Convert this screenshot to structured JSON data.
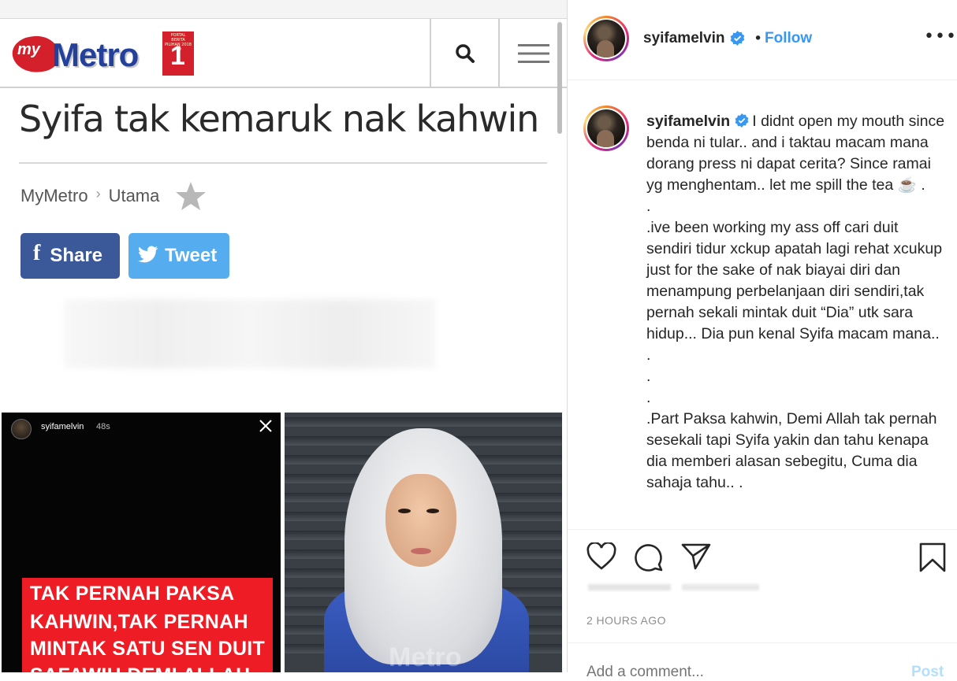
{
  "article": {
    "site_logo": {
      "my": "my",
      "brand": "Metro",
      "badge_number": "1",
      "badge_small_text": "PORTAL BERITA PILIHAN 2018 NO"
    },
    "headline": "Syifa tak kemaruk nak kahwin",
    "breadcrumb": [
      "MyMetro",
      "Utama"
    ],
    "share_label": "Share",
    "tweet_label": "Tweet",
    "story": {
      "username": "syifamelvin",
      "time": "48s",
      "callout_lines": [
        "TAK PERNAH PAKSA",
        "KAHWIN,TAK PERNAH",
        "MINTAK SATU SEN DUIT",
        "SAFAWIH.DEMI ALLAH"
      ]
    },
    "photo_watermark": "Metro",
    "icons": {
      "search": "search-icon",
      "menu": "hamburger-menu-icon",
      "star": "star-icon",
      "close": "close-icon"
    },
    "colors": {
      "facebook": "#3b5998",
      "twitter": "#55acee",
      "callout_red": "#ee1c24",
      "metro_blue": "#23409a"
    }
  },
  "instagram": {
    "username": "syifamelvin",
    "follow_label": "Follow",
    "more_icon": "•••",
    "caption_user": "syifamelvin",
    "caption_paragraphs": [
      "I didnt open my mouth since benda ni tular.. and i taktau macam mana dorang press ni dapat cerita? Since ramai yg menghentam.. let me spill the tea ☕ .",
      ".",
      ".ive been working my ass off cari duit sendiri tidur xckup apatah lagi rehat xcukup just for the sake of nak biayai diri dan menampung perbelanjaan diri sendiri,tak pernah sekali mintak duit “Dia” utk sara hidup... Dia pun kenal Syifa macam mana.. .",
      ".",
      ".",
      ".Part Paksa kahwin, Demi Allah tak pernah sesekali tapi Syifa yakin dan tahu kenapa dia memberi alasan sebegitu, Cuma dia sahaja tahu.. ."
    ],
    "timestamp": "2 HOURS AGO",
    "comment_placeholder": "Add a comment...",
    "post_label": "Post",
    "colors": {
      "link_blue": "#3897f0",
      "text": "#262626",
      "muted": "#8e8e8e"
    }
  }
}
